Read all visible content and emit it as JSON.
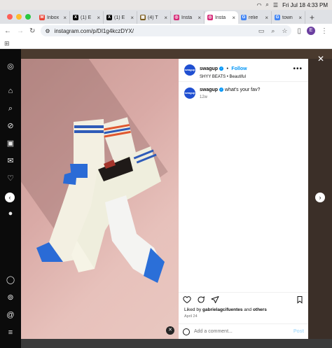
{
  "menubar": {
    "clock": "Fri Jul 18  4:33 PM"
  },
  "tabs": [
    {
      "label": "Inbox",
      "fav": "M",
      "color": "#ea4335"
    },
    {
      "label": "(1) E",
      "fav": "X",
      "color": "#000000"
    },
    {
      "label": "(1) E",
      "fav": "X",
      "color": "#000000"
    },
    {
      "label": "(4) T",
      "fav": "▦",
      "color": "#7a5a1a"
    },
    {
      "label": "Insta",
      "fav": "◎",
      "color": "#d62976"
    },
    {
      "label": "Insta",
      "fav": "◎",
      "color": "#d62976",
      "active": true
    },
    {
      "label": "relie",
      "fav": "G",
      "color": "#4285f4"
    },
    {
      "label": "town",
      "fav": "G",
      "color": "#4285f4"
    }
  ],
  "address": {
    "url": "instagram.com/p/DI1g4kczDYX/"
  },
  "profile": {
    "initial": "E"
  },
  "post": {
    "username": "swagup",
    "follow_label": "Follow",
    "audio": "SHYY BEATS • Beautiful",
    "avatar_text": "swagup",
    "caption_user": "swagup",
    "caption_text": "what's your fav?",
    "caption_time": "12w",
    "liked_by_prefix": "Liked by",
    "liked_by_user": "gabrielagcifuentes",
    "liked_by_and": "and",
    "liked_by_others": "others",
    "date": "April 24",
    "add_comment_placeholder": "Add a comment...",
    "post_button": "Post"
  },
  "icons": {
    "close": "close-icon",
    "prev": "chevron-left-icon",
    "next": "chevron-right-icon"
  }
}
